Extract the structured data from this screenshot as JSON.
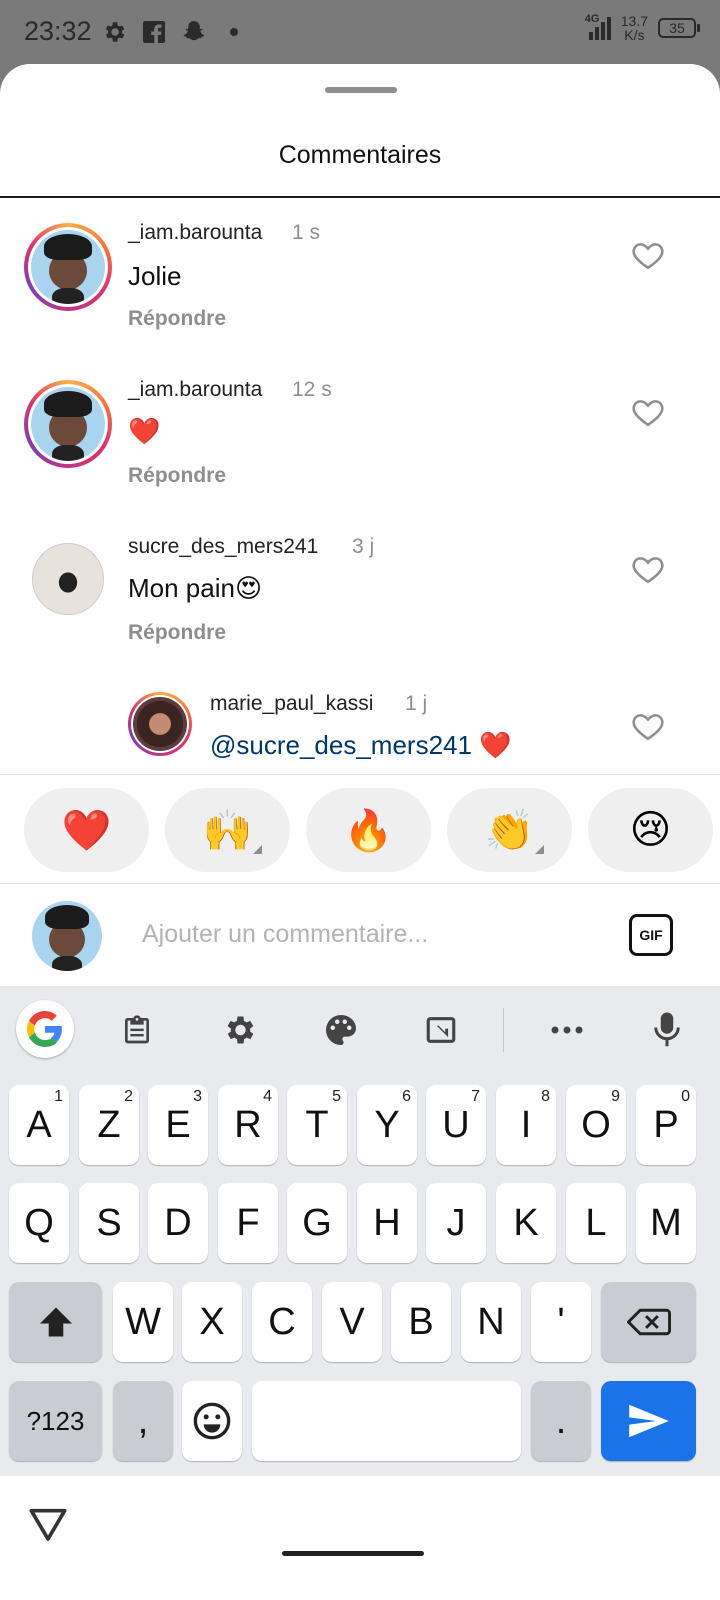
{
  "status_bar": {
    "time": "23:32",
    "icons": [
      "settings-icon",
      "facebook-icon",
      "snapchat-icon",
      "dot-icon"
    ],
    "network": "4G",
    "speed_value": "13.7",
    "speed_unit": "K/s",
    "battery": "35"
  },
  "sheet": {
    "title": "Commentaires"
  },
  "comments": [
    {
      "username": "_iam.barounta",
      "time": "1 s",
      "text": "Jolie",
      "reply": "Répondre"
    },
    {
      "username": "_iam.barounta",
      "time": "12 s",
      "text": "❤️",
      "reply": "Répondre"
    },
    {
      "username": "sucre_des_mers241",
      "time": "3 j",
      "text": "Mon pain😍",
      "reply": "Répondre"
    },
    {
      "username": "marie_paul_kassi",
      "time": "1 j",
      "mention": "@sucre_des_mers241",
      "text": " ❤️"
    }
  ],
  "quick_reactions": [
    "❤️",
    "🙌",
    "🔥",
    "👏",
    "😢"
  ],
  "comment_input": {
    "placeholder": "Ajouter un commentaire...",
    "gif_label": "GIF"
  },
  "keyboard": {
    "row1": [
      {
        "k": "A",
        "h": "1"
      },
      {
        "k": "Z",
        "h": "2"
      },
      {
        "k": "E",
        "h": "3"
      },
      {
        "k": "R",
        "h": "4"
      },
      {
        "k": "T",
        "h": "5"
      },
      {
        "k": "Y",
        "h": "6"
      },
      {
        "k": "U",
        "h": "7"
      },
      {
        "k": "I",
        "h": "8"
      },
      {
        "k": "O",
        "h": "9"
      },
      {
        "k": "P",
        "h": "0"
      }
    ],
    "row2": [
      "Q",
      "S",
      "D",
      "F",
      "G",
      "H",
      "J",
      "K",
      "L",
      "M"
    ],
    "row3": [
      "W",
      "X",
      "C",
      "V",
      "B",
      "N",
      "'"
    ],
    "symbols_label": "?123",
    "comma": ",",
    "period": ".",
    "accent_color": "#1a73e8"
  }
}
